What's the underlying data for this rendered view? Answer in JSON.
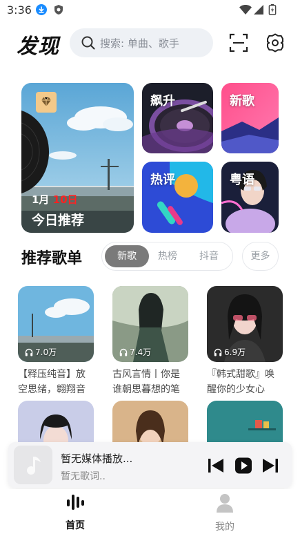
{
  "status_bar": {
    "time": "3:36"
  },
  "header": {
    "title": "发现",
    "search_placeholder": "搜索: 单曲、歌手"
  },
  "banner": {
    "date_month": "1月",
    "date_day": "10日",
    "main_label": "今日推荐",
    "tiles": [
      "飙升",
      "新歌",
      "热评",
      "粤语"
    ]
  },
  "playlists": {
    "section_title": "推荐歌单",
    "tabs": [
      "新歌",
      "热榜",
      "抖音"
    ],
    "active_tab": "新歌",
    "more_label": "更多",
    "items": [
      {
        "count": "7.0万",
        "title": "【释压纯音】放空思绪，翱翔音"
      },
      {
        "count": "7.4万",
        "title": "古风言情丨你是谁朝思暮想的笔"
      },
      {
        "count": "6.9万",
        "title": "『韩式甜歌』唤醒你的少女心"
      },
      {
        "count": "",
        "title": ""
      },
      {
        "count": "",
        "title": ""
      },
      {
        "count": "",
        "title": ""
      }
    ]
  },
  "mini_player": {
    "title": "暂无媒体播放...",
    "subtitle": "暂无歌词.."
  },
  "bottom_nav": {
    "items": [
      {
        "label": "首页",
        "icon": "music-bars-icon"
      },
      {
        "label": "我的",
        "icon": "person-icon"
      }
    ]
  },
  "colors": {
    "accent_active_tab": "#7a7a7a",
    "date_highlight": "#ff2222",
    "search_bg": "#eef1f5"
  }
}
